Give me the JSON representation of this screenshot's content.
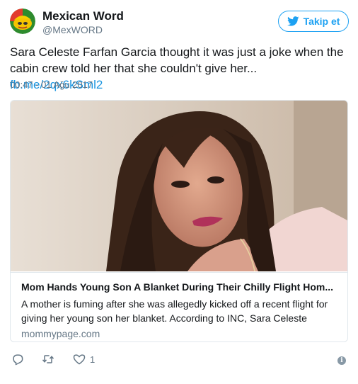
{
  "author": {
    "name": "Mexican Word",
    "handle": "@MexWORD",
    "avatar_icon": "avatar-image"
  },
  "follow_button": {
    "label": "Takip et",
    "icon": "bird-icon",
    "color": "#1da1f2"
  },
  "tweet": {
    "text": "Sara Celeste Farfan Garcia thought it was just a joke when the cabin crew told her that she couldn't give her... ",
    "link_text": "fb.me/2qx6kSml2",
    "timestamp": "00:47 - 01 Ağu 2017"
  },
  "card": {
    "image_icon": "woman-photo",
    "title": "Mom Hands Young Son A Blanket During Their Chilly Flight Hom...",
    "description": "A mother is fuming after she was allegedly kicked off a recent flight for giving her young son her blanket. According to INC, Sara Celeste",
    "domain": "mommypage.com"
  },
  "actions": {
    "reply_icon": "reply-icon",
    "retweet_icon": "retweet-icon",
    "like_icon": "heart-icon",
    "like_count": "1",
    "info_icon": "info-icon",
    "info_glyph": "i"
  },
  "colors": {
    "link": "#1b95e0",
    "secondary_text": "#657786",
    "border": "#e1e8ed"
  }
}
